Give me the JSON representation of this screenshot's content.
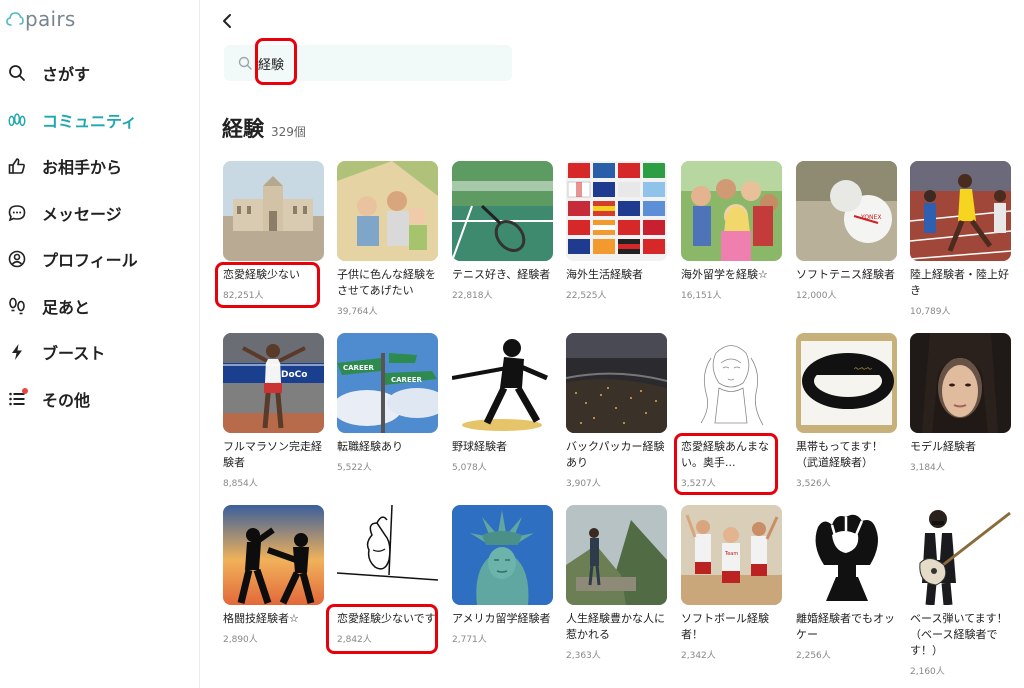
{
  "app": {
    "logo_text": "pairs"
  },
  "sidebar": {
    "items": [
      {
        "label": "さがす",
        "icon": "search-icon",
        "active": false
      },
      {
        "label": "コミュニティ",
        "icon": "community-icon",
        "active": true
      },
      {
        "label": "お相手から",
        "icon": "thumbs-up-icon",
        "active": false
      },
      {
        "label": "メッセージ",
        "icon": "message-icon",
        "active": false
      },
      {
        "label": "プロフィール",
        "icon": "profile-icon",
        "active": false
      },
      {
        "label": "足あと",
        "icon": "footprints-icon",
        "active": false
      },
      {
        "label": "ブースト",
        "icon": "lightning-icon",
        "active": false
      },
      {
        "label": "その他",
        "icon": "menu-list-icon",
        "active": false,
        "badge": true
      }
    ]
  },
  "search": {
    "value": "経験",
    "placeholder": ""
  },
  "results": {
    "title": "経験",
    "count": "329個"
  },
  "communities": [
    {
      "title": "恋愛経験少ない",
      "members": "82,251人",
      "highlight": true,
      "image": "palace-photo"
    },
    {
      "title": "子供に色んな経験をさせてあげたい",
      "members": "39,764人",
      "image": "family-tent-photo"
    },
    {
      "title": "テニス好き、経験者",
      "members": "22,818人",
      "image": "tennis-racket-photo"
    },
    {
      "title": "海外生活経験者",
      "members": "22,525人",
      "image": "flags-grid-photo"
    },
    {
      "title": "海外留学を経験☆",
      "members": "16,151人",
      "image": "students-group-photo"
    },
    {
      "title": "ソフトテニス経験者",
      "members": "12,000人",
      "image": "soft-tennis-ball-photo"
    },
    {
      "title": "陸上経験者・陸上好き",
      "members": "10,789人",
      "image": "track-runners-photo"
    },
    {
      "title": "フルマラソン完走経験者",
      "members": "8,854人",
      "image": "marathon-finish-photo"
    },
    {
      "title": "転職経験あり",
      "members": "5,522人",
      "image": "career-signs-photo"
    },
    {
      "title": "野球経験者",
      "members": "5,078人",
      "image": "batter-silhouette"
    },
    {
      "title": "バックパッカー経験あり",
      "members": "3,907人",
      "image": "night-city-photo"
    },
    {
      "title": "恋愛経験あんまない。奥手...",
      "members": "3,527人",
      "highlight": true,
      "image": "sketch-girl"
    },
    {
      "title": "黒帯もってます！（武道経験者）",
      "members": "3,526人",
      "image": "black-belt-photo"
    },
    {
      "title": "モデル経験者",
      "members": "3,184人",
      "image": "model-portrait-photo"
    },
    {
      "title": "格闘技経験者☆",
      "members": "2,890人",
      "image": "fighters-sunset"
    },
    {
      "title": "恋愛経験少ないです",
      "members": "2,842人",
      "highlight": true,
      "image": "hand-drawing"
    },
    {
      "title": "アメリカ留学経験者",
      "members": "2,771人",
      "image": "statue-of-liberty-photo"
    },
    {
      "title": "人生経験豊かな人に惹かれる",
      "members": "2,363人",
      "image": "machu-picchu-photo"
    },
    {
      "title": "ソフトボール経験者！",
      "members": "2,342人",
      "image": "softball-team-photo"
    },
    {
      "title": "離婚経験者でもオッケー",
      "members": "2,256人",
      "image": "glove-trophy"
    },
    {
      "title": "ベース弾いてます！（ベース経験者です！）",
      "members": "2,160人",
      "image": "bassist-photo"
    }
  ],
  "colors": {
    "accent": "#1fa8b0",
    "highlight_border": "#e8000b",
    "search_bg": "#f2f9f9"
  }
}
